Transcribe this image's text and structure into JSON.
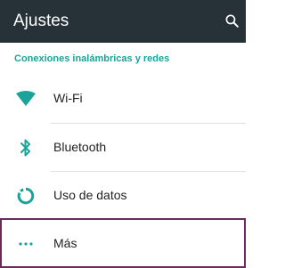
{
  "appbar": {
    "title": "Ajustes",
    "search_icon": "search-icon",
    "background": "#263238"
  },
  "section": {
    "header": "Conexiones inalámbricas y redes",
    "accent": "#1aa39a"
  },
  "items": [
    {
      "label": "Wi-Fi",
      "icon": "wifi-icon"
    },
    {
      "label": "Bluetooth",
      "icon": "bluetooth-icon"
    },
    {
      "label": "Uso de datos",
      "icon": "data-usage-icon"
    },
    {
      "label": "Más",
      "icon": "more-icon",
      "selected": true
    }
  ]
}
